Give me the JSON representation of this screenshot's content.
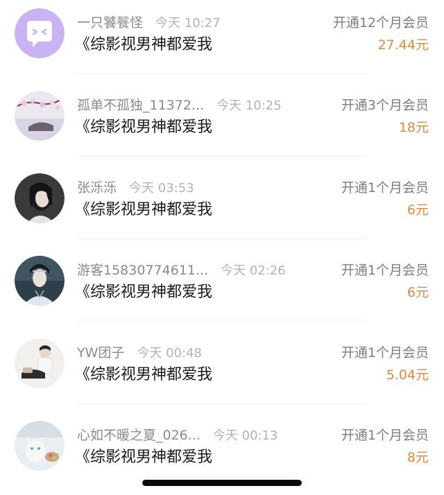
{
  "rows": [
    {
      "name": "一只饕餮怪",
      "time": "今天 10:27",
      "title": "《综影视男神都爱我",
      "plan": "开通12个月会员",
      "price": "27.44元",
      "avatar": "default-purple-avatar"
    },
    {
      "name": "孤单不孤独_11372...",
      "time": "今天 10:25",
      "title": "《综影视男神都爱我",
      "plan": "开通3个月会员",
      "price": "18元",
      "avatar": "cherry-blossom-avatar"
    },
    {
      "name": "张泺泺",
      "time": "今天 03:53",
      "title": "《综影视男神都爱我",
      "plan": "开通1个月会员",
      "price": "6元",
      "avatar": "girl-portrait-avatar"
    },
    {
      "name": "游客15830774611...",
      "time": "今天 02:26",
      "title": "《综影视男神都爱我",
      "plan": "开通1个月会员",
      "price": "6元",
      "avatar": "costume-man-avatar"
    },
    {
      "name": "YW团子",
      "time": "今天 00:48",
      "title": "《综影视男神都爱我",
      "plan": "开通1个月会员",
      "price": "5.04元",
      "avatar": "boy-photo-avatar"
    },
    {
      "name": "心如不暖之夏_026...",
      "time": "今天 00:13",
      "title": "《综影视男神都爱我",
      "plan": "开通1个月会员",
      "price": "8元",
      "avatar": "cat-avatar"
    }
  ],
  "colors": {
    "price": "#e08a3c",
    "avatar_purple": "#c9b3f2"
  }
}
